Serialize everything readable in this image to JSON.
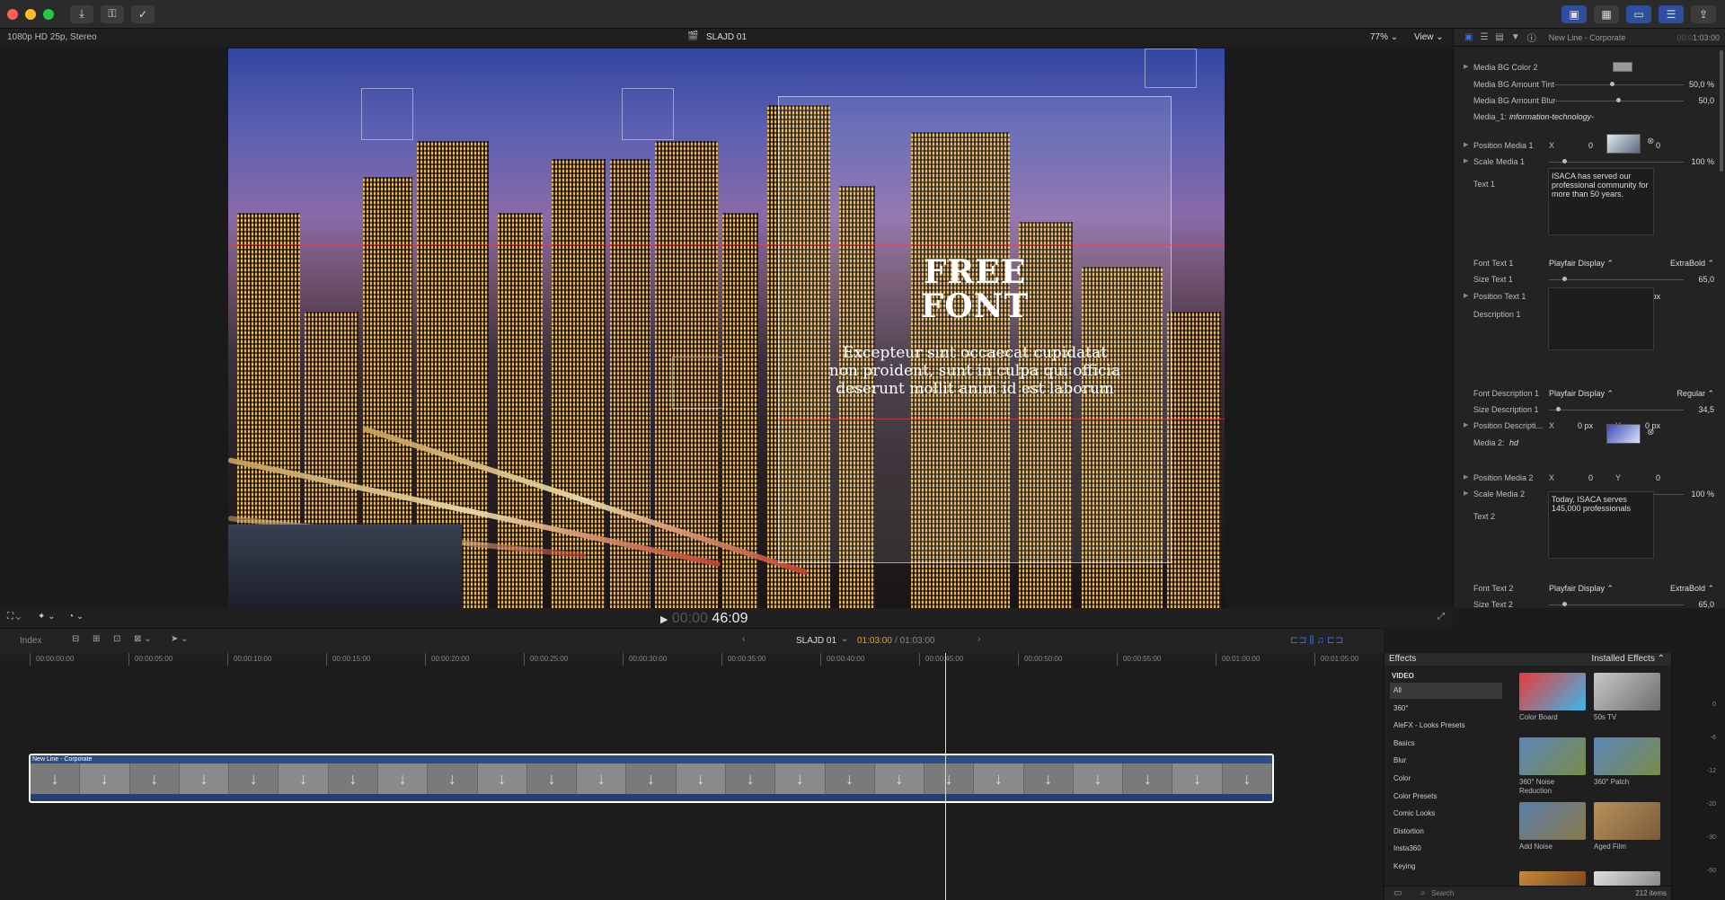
{
  "window": {
    "format": "1080p HD 25p, Stereo",
    "project_title": "SLAJD 01",
    "zoom": "77%",
    "view": "View"
  },
  "title": {
    "line1": "FREE",
    "line2": "FONT"
  },
  "description": [
    "Excepteur sint occaecat cupidatat",
    "non proident, sunt in culpa qui officia",
    "deserunt mollit anim id est laborum"
  ],
  "playback": {
    "timecode_dim": "00:00",
    "timecode": "46:09"
  },
  "timeline_bar": {
    "index": "Index",
    "clip_name": "SLAJD 01",
    "timecode_cur": "01:03:00",
    "timecode_total": "/ 01:03:00"
  },
  "ruler": [
    "00:00:00:00",
    "00:00:05:00",
    "00:00:10:00",
    "00:00:15:00",
    "00:00:20:00",
    "00:00:25:00",
    "00:00:30:00",
    "00:00:35:00",
    "00:00:40:00",
    "00:00:45:00",
    "00:00:50:00",
    "00:00:55:00",
    "00:01:00:00",
    "00:01:05:00"
  ],
  "clip": {
    "label": "New Line - Corporate",
    "arrow": "↓"
  },
  "inspector": {
    "title": "New Line - Corporate",
    "time_dim": "00:0",
    "time": "1:03:00",
    "rows": [
      {
        "label": "Media BG Color 2",
        "tri": true
      },
      {
        "label": "Media BG Amount Tint",
        "v2": "50,0 %",
        "slider": true,
        "knob": 0.45
      },
      {
        "label": "Media BG Amount Blur",
        "v2": "50,0",
        "slider": true,
        "knob": 0.5
      },
      {
        "label": "Media_1:",
        "italic": "information-technology-"
      },
      {
        "label": "Position Media 1",
        "tri": true,
        "x": "X",
        "xv": "0",
        "y": "Y",
        "yv": "0"
      },
      {
        "label": "Scale Media 1",
        "tri": true,
        "v2": "100 %",
        "slider": true,
        "knob": 0.1
      },
      {
        "label": "Text 1"
      },
      {
        "label": "Font Text 1",
        "v1": "Playfair Display  ⌃",
        "v2": "ExtraBold  ⌃"
      },
      {
        "label": "Size Text 1",
        "v2": "65,0",
        "slider": true,
        "knob": 0.1
      },
      {
        "label": "Position Text 1",
        "tri": true,
        "x": "X",
        "xv": "0 px",
        "y": "Y",
        "yv": "0 px"
      },
      {
        "label": "Description 1"
      },
      {
        "label": "Font Description 1",
        "v1": "Playfair Display  ⌃",
        "v2": "Regular  ⌃"
      },
      {
        "label": "Size Description 1",
        "v2": "34,5",
        "slider": true,
        "knob": 0.05
      },
      {
        "label": "Position Descripti...",
        "tri": true,
        "x": "X",
        "xv": "0 px",
        "y": "Y",
        "yv": "0 px"
      },
      {
        "label": "Media 2:",
        "italic": "hd"
      },
      {
        "label": "Position Media 2",
        "tri": true,
        "x": "X",
        "xv": "0",
        "y": "Y",
        "yv": "0"
      },
      {
        "label": "Scale Media 2",
        "tri": true,
        "v2": "100 %",
        "slider": true,
        "knob": 0.1
      },
      {
        "label": "Text 2"
      },
      {
        "label": "Font Text 2",
        "v1": "Playfair Display  ⌃",
        "v2": "ExtraBold  ⌃"
      },
      {
        "label": "Size Text 2",
        "v2": "65,0",
        "slider": true,
        "knob": 0.1
      }
    ],
    "text1": "ISACA has served our professional community for more than 50 years.",
    "text2": "Today, ISACA serves 145,000 professionals"
  },
  "effects": {
    "header": "Effects",
    "installed": "Installed Effects  ⌃",
    "video": "VIDEO",
    "categories": [
      "All",
      "360°",
      "AleFX - Looks Presets",
      "Basics",
      "Blur",
      "Color",
      "Color Presets",
      "Comic Looks",
      "Distortion",
      "Insta360",
      "Keying"
    ],
    "tiles": [
      {
        "label": "Color Board",
        "c1": "#e83b3b",
        "c2": "#3bb8e8"
      },
      {
        "label": "50s TV",
        "c1": "#c8c8c8",
        "c2": "#6d6d6d"
      },
      {
        "label": "360° Noise Reduction",
        "c1": "#5b86b8",
        "c2": "#7a8b4a"
      },
      {
        "label": "360° Patch",
        "c1": "#5b86b8",
        "c2": "#7a8b4a"
      },
      {
        "label": "Add Noise",
        "c1": "#5a7ea8",
        "c2": "#8a7a4a"
      },
      {
        "label": "Aged Film",
        "c1": "#b8925b",
        "c2": "#7a5a3a"
      }
    ],
    "search": "Search",
    "items": "212 items"
  },
  "meter": [
    "0",
    "-6",
    "-12",
    "-20",
    "-30",
    "-50"
  ],
  "colors": {
    "accent": "#3b6fd8",
    "panel": "#232323",
    "clip_border": "#ffffff",
    "timecode_orange": "#d6a13a"
  }
}
